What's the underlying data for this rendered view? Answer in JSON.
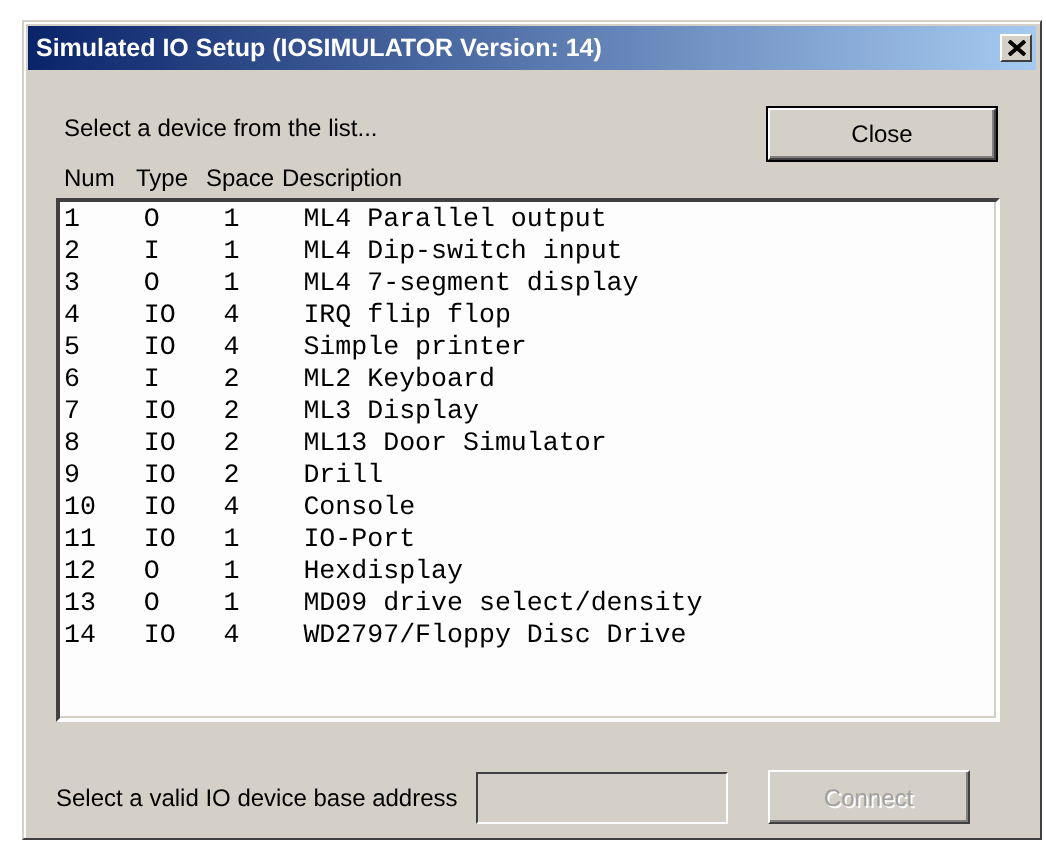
{
  "window": {
    "title": "Simulated IO Setup (IOSIMULATOR Version: 14)"
  },
  "prompt": "Select a device from the list...",
  "close_button": {
    "label": "Close"
  },
  "list": {
    "columns": [
      "Num",
      "Type",
      "Space",
      "Description"
    ],
    "rows": [
      {
        "num": "1",
        "type": "O",
        "space": "1",
        "description": "ML4 Parallel output",
        "selected": false
      },
      {
        "num": "2",
        "type": "I",
        "space": "1",
        "description": "ML4 Dip-switch input",
        "selected": false
      },
      {
        "num": "3",
        "type": "O",
        "space": "1",
        "description": "ML4 7-segment display",
        "selected": false
      },
      {
        "num": "4",
        "type": "IO",
        "space": "4",
        "description": "IRQ flip flop",
        "selected": false
      },
      {
        "num": "5",
        "type": "IO",
        "space": "4",
        "description": "Simple printer",
        "selected": false
      },
      {
        "num": "6",
        "type": "I",
        "space": "2",
        "description": "ML2 Keyboard",
        "selected": false
      },
      {
        "num": "7",
        "type": "IO",
        "space": "2",
        "description": "ML3 Display",
        "selected": false
      },
      {
        "num": "8",
        "type": "IO",
        "space": "2",
        "description": "ML13 Door Simulator",
        "selected": false
      },
      {
        "num": "9",
        "type": "IO",
        "space": "2",
        "description": "Drill",
        "selected": false
      },
      {
        "num": "10",
        "type": "IO",
        "space": "4",
        "description": "Console",
        "selected": false
      },
      {
        "num": "11",
        "type": "IO",
        "space": "1",
        "description": "IO-Port",
        "selected": false
      },
      {
        "num": "12",
        "type": "O",
        "space": "1",
        "description": "Hexdisplay",
        "selected": false
      },
      {
        "num": "13",
        "type": "O",
        "space": "1",
        "description": "MD09 drive select/density",
        "selected": false
      },
      {
        "num": "14",
        "type": "IO",
        "space": "4",
        "description": "WD2797/Floppy Disc Drive",
        "selected": false
      }
    ]
  },
  "address": {
    "label": "Select a valid IO device base address",
    "disabled": true
  },
  "connect_button": {
    "label": "Connect",
    "disabled": true
  }
}
